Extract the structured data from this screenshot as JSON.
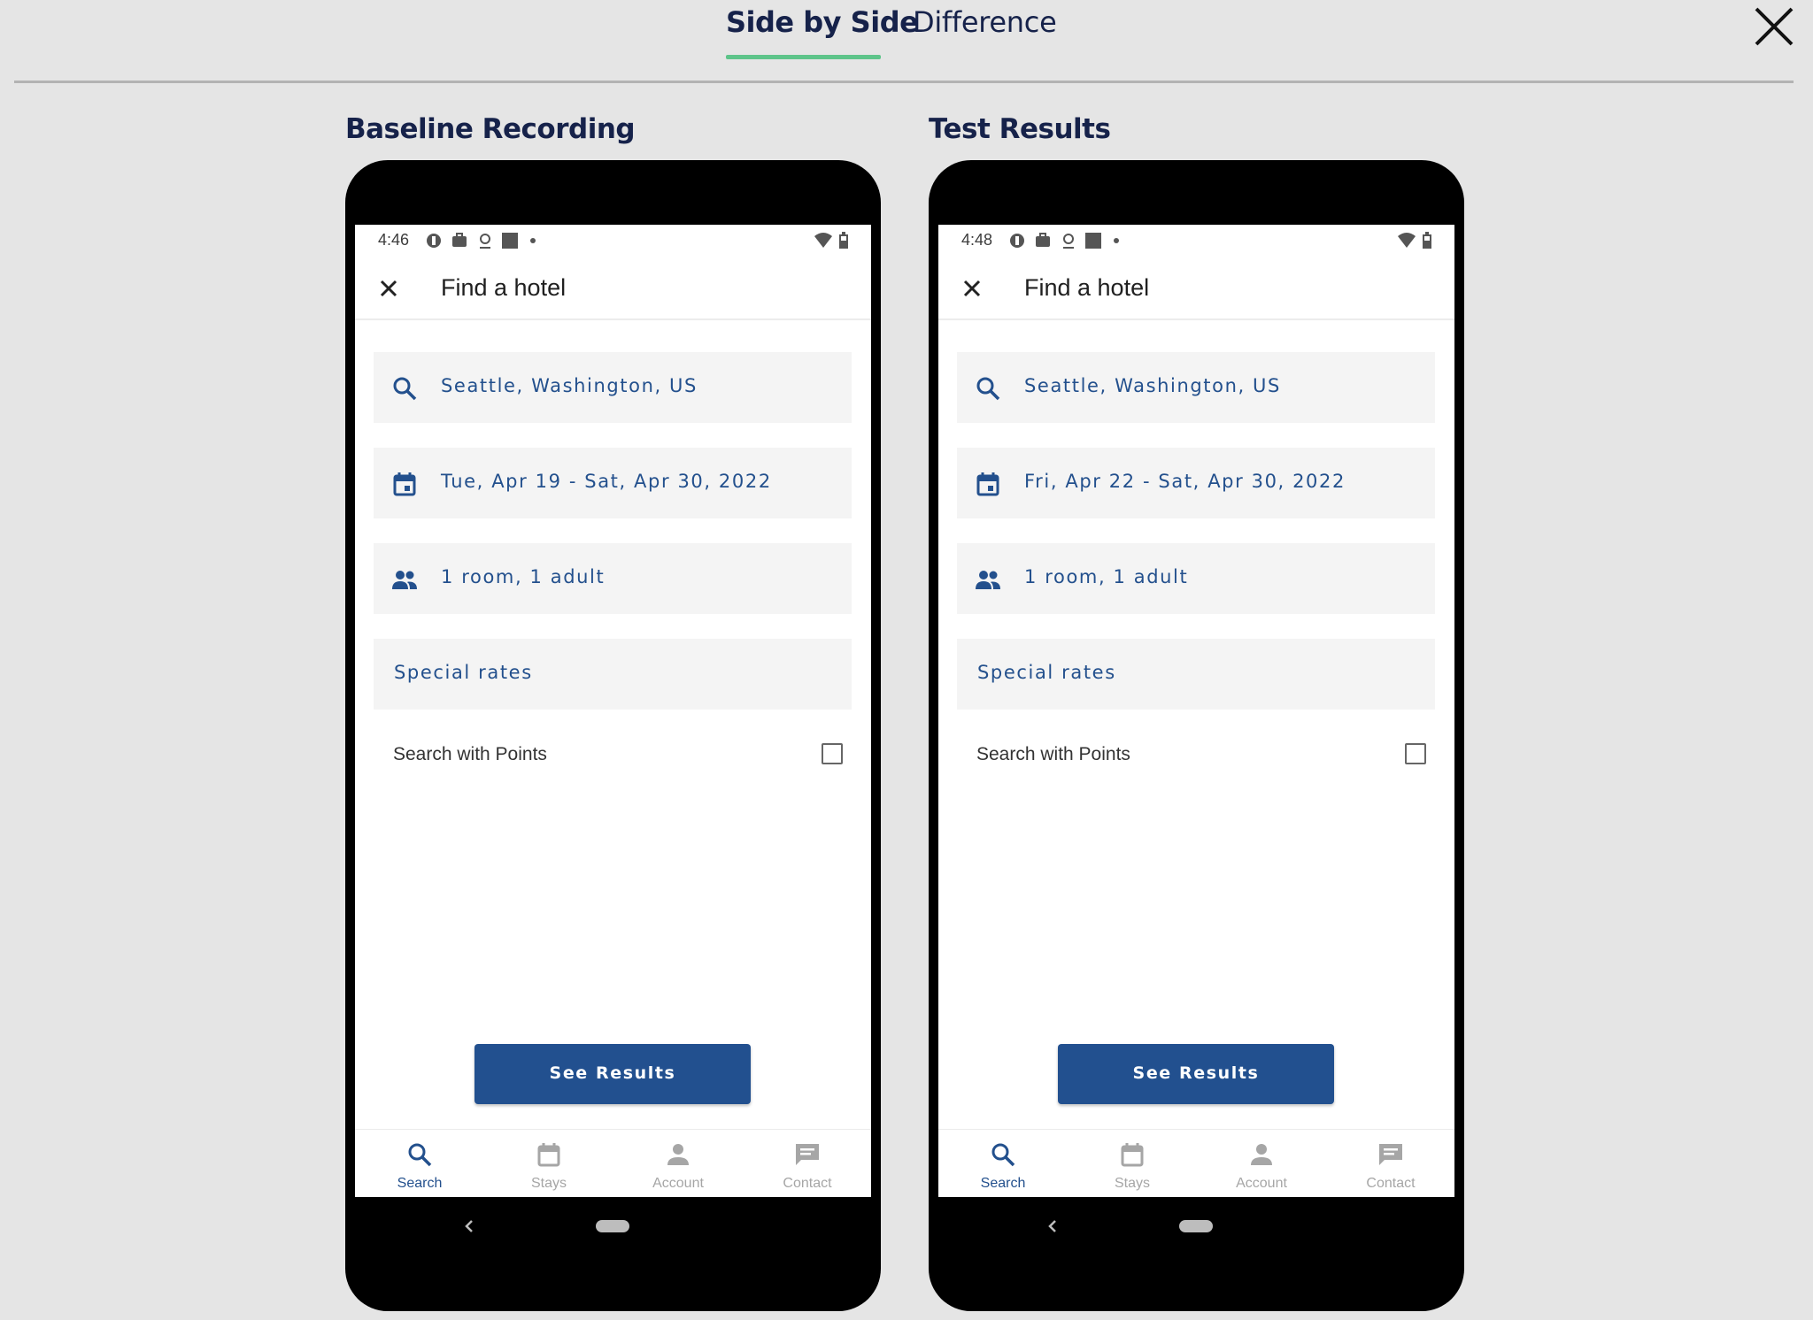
{
  "tabs": [
    {
      "label": "Side by Side",
      "active": true
    },
    {
      "label": "Difference",
      "active": false
    }
  ],
  "colors": {
    "accent_underline": "#5ec48a",
    "brand_blue": "#22508f",
    "heading_navy": "#16224a"
  },
  "panels": [
    {
      "title": "Baseline Recording",
      "status_time": "4:46",
      "header_title": "Find a hotel",
      "location": "Seattle, Washington, US",
      "dates": "Tue, Apr 19 - Sat, Apr 30, 2022",
      "guests": "1 room, 1 adult",
      "special_rates": "Special rates",
      "points_label": "Search with Points",
      "points_checked": false,
      "button": "See Results",
      "nav": [
        "Search",
        "Stays",
        "Account",
        "Contact"
      ]
    },
    {
      "title": "Test Results",
      "status_time": "4:48",
      "header_title": "Find a hotel",
      "location": "Seattle, Washington, US",
      "dates": "Fri, Apr 22 - Sat, Apr 30, 2022",
      "guests": "1 room, 1 adult",
      "special_rates": "Special rates",
      "points_label": "Search with Points",
      "points_checked": false,
      "button": "See Results",
      "nav": [
        "Search",
        "Stays",
        "Account",
        "Contact"
      ]
    }
  ],
  "icons": {
    "close": "close-icon",
    "search": "search-icon",
    "calendar": "calendar-icon",
    "people": "people-icon",
    "account": "person-icon",
    "contact": "chat-icon"
  }
}
